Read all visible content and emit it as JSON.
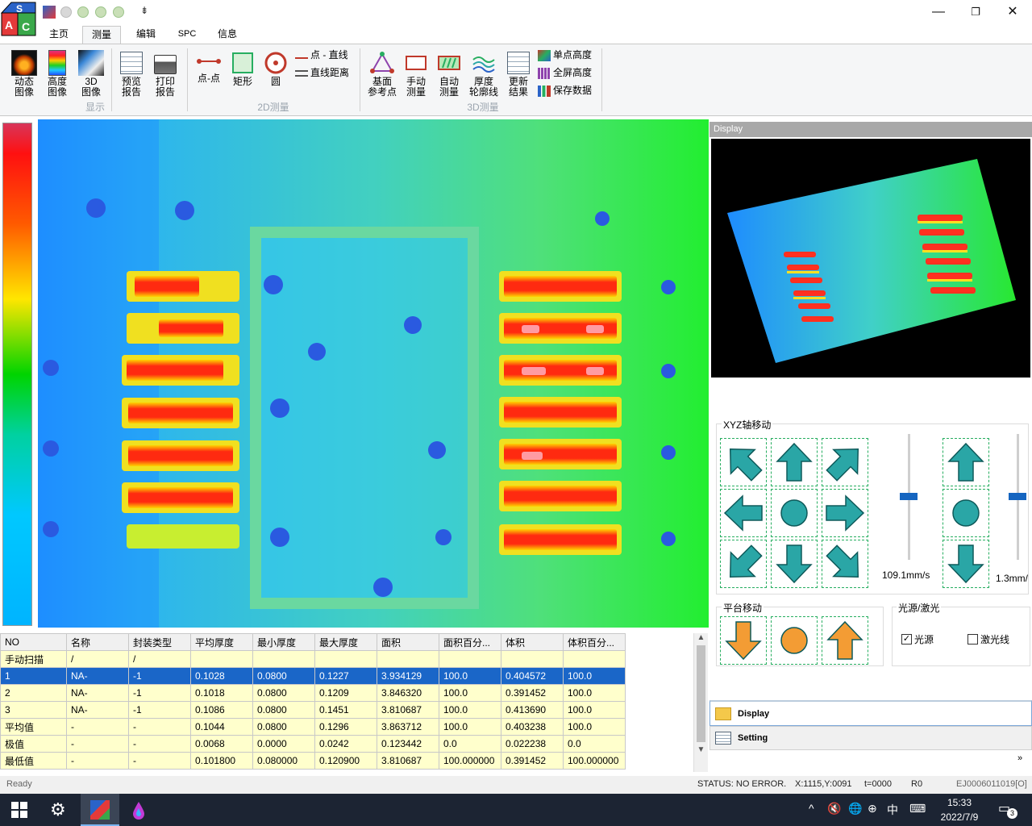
{
  "titlebar": {
    "minimize": "—",
    "restore": "❐",
    "close": "✕",
    "qa_extra": "⇟"
  },
  "tabs": [
    "主页",
    "测量",
    "编辑",
    "SPC",
    "信息"
  ],
  "ribbon": {
    "display_group": "显示",
    "measure2d_group": "2D测量",
    "measure3d_group": "3D测量",
    "buttons": {
      "dynamic_ref": [
        "动态",
        "图像"
      ],
      "height_img": [
        "高度",
        "图像"
      ],
      "img3d": [
        "3D",
        "图像"
      ],
      "preview_report": [
        "预览",
        "报告"
      ],
      "print_report": [
        "打印",
        "报告"
      ],
      "point_point": "点-点",
      "rect": "矩形",
      "circle": "圆",
      "point_line": "点 - 直线",
      "line_dist": "直线距离",
      "base_ref": [
        "基面",
        "参考点"
      ],
      "manual_measure": [
        "手动",
        "测量"
      ],
      "auto_measure": [
        "自动",
        "测量"
      ],
      "thickness_contour": [
        "厚度",
        "轮廓线"
      ],
      "update_result": [
        "更新",
        "结果"
      ],
      "single_height": "单点高度",
      "full_height": "全屏高度",
      "save_data": "保存数据"
    }
  },
  "right": {
    "display_header": "Display",
    "xyz_title": "XYZ轴移动",
    "speed_xy": "109.1mm/s",
    "speed_z": "1.3mm/",
    "platform_title": "平台移动",
    "light_title": "光源/激光",
    "light_label": "光源",
    "laser_label": "激光线",
    "light_checked": true,
    "laser_checked": false,
    "nav_display": "Display",
    "nav_setting": "Setting"
  },
  "table": {
    "headers": [
      "NO",
      "名称",
      "封装类型",
      "平均厚度",
      "最小厚度",
      "最大厚度",
      "面积",
      "面积百分...",
      "体积",
      "体积百分..."
    ],
    "rows": [
      {
        "cells": [
          "手动扫描",
          "/",
          "/",
          "",
          "",
          "",
          "",
          "",
          "",
          ""
        ],
        "style": "yel"
      },
      {
        "cells": [
          "1",
          "NA-",
          "-1",
          "0.1028",
          "0.0800",
          "0.1227",
          "3.934129",
          "100.0",
          "0.404572",
          "100.0"
        ],
        "style": "sel"
      },
      {
        "cells": [
          "2",
          "NA-",
          "-1",
          "0.1018",
          "0.0800",
          "0.1209",
          "3.846320",
          "100.0",
          "0.391452",
          "100.0"
        ],
        "style": "yel"
      },
      {
        "cells": [
          "3",
          "NA-",
          "-1",
          "0.1086",
          "0.0800",
          "0.1451",
          "3.810687",
          "100.0",
          "0.413690",
          "100.0"
        ],
        "style": "yel"
      },
      {
        "cells": [
          "平均值",
          "-",
          "-",
          "0.1044",
          "0.0800",
          "0.1296",
          "3.863712",
          "100.0",
          "0.403238",
          "100.0"
        ],
        "style": "yel"
      },
      {
        "cells": [
          "极值",
          "-",
          "-",
          "0.0068",
          "0.0000",
          "0.0242",
          "0.123442",
          "0.0",
          "0.022238",
          "0.0"
        ],
        "style": "yel"
      },
      {
        "cells": [
          "最低值",
          "-",
          "-",
          "0.101800",
          "0.080000",
          "0.120900",
          "3.810687",
          "100.000000",
          "0.391452",
          "100.000000"
        ],
        "style": "yel"
      }
    ]
  },
  "status": {
    "ready": "Ready",
    "status": "STATUS: NO ERROR.",
    "coords": "X:1115,Y:0091",
    "t": "t=0000",
    "r": "R0",
    "id": "EJ0006011019[O]"
  },
  "taskbar": {
    "time": "15:33",
    "date": "2022/7/9",
    "ime": "中",
    "notify_count": "3"
  },
  "colors": {
    "selected_row": "#1a66c8",
    "grid_row": "#ffffcc",
    "arrow_teal": "#2aa6a6",
    "platform_orange": "#f39c34"
  }
}
